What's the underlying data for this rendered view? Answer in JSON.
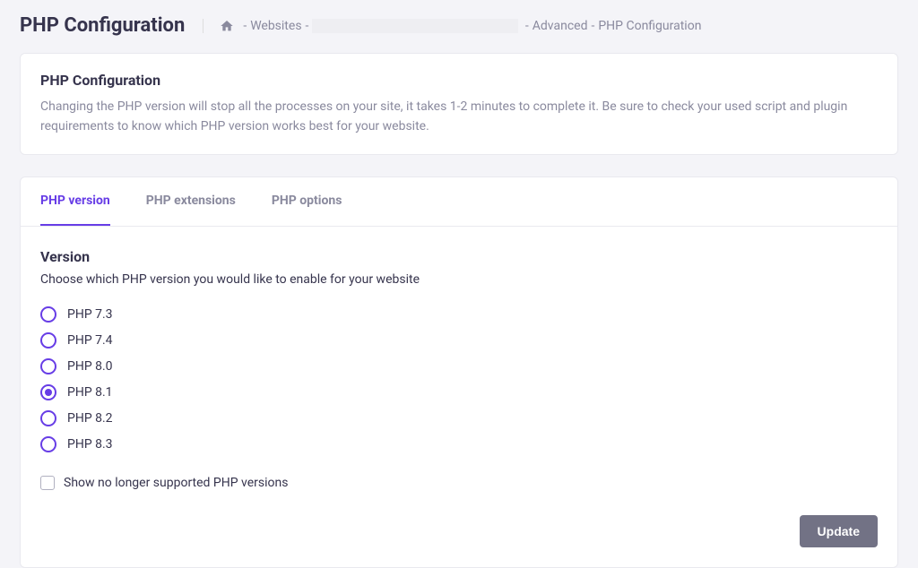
{
  "page": {
    "title": "PHP Configuration"
  },
  "breadcrumb": {
    "websites": "Websites",
    "advanced": "Advanced",
    "php_config": "PHP Configuration"
  },
  "info_panel": {
    "title": "PHP Configuration",
    "description": "Changing the PHP version will stop all the processes on your site, it takes 1-2 minutes to complete it. Be sure to check your used script and plugin requirements to know which PHP version works best for your website."
  },
  "tabs": [
    {
      "label": "PHP version",
      "active": true
    },
    {
      "label": "PHP extensions",
      "active": false
    },
    {
      "label": "PHP options",
      "active": false
    }
  ],
  "version_section": {
    "heading": "Version",
    "description": "Choose which PHP version you would like to enable for your website"
  },
  "php_versions": [
    {
      "label": "PHP 7.3",
      "selected": false
    },
    {
      "label": "PHP 7.4",
      "selected": false
    },
    {
      "label": "PHP 8.0",
      "selected": false
    },
    {
      "label": "PHP 8.1",
      "selected": true
    },
    {
      "label": "PHP 8.2",
      "selected": false
    },
    {
      "label": "PHP 8.3",
      "selected": false
    }
  ],
  "checkbox": {
    "label": "Show no longer supported PHP versions",
    "checked": false
  },
  "buttons": {
    "update": "Update"
  }
}
